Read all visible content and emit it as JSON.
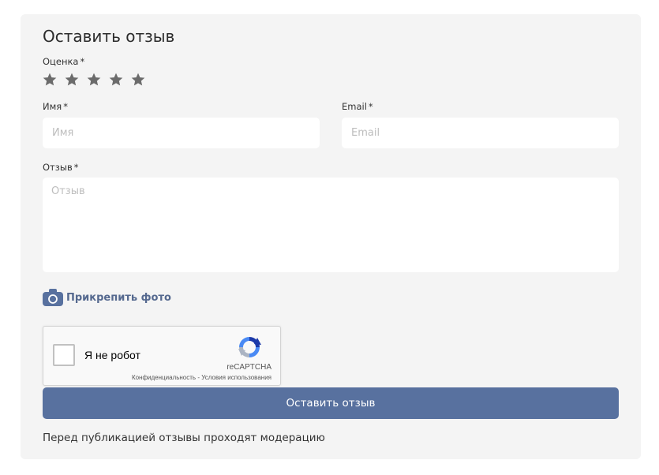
{
  "form": {
    "title": "Оставить отзыв",
    "rating_label": "Оценка",
    "required_mark": "*",
    "stars": 5,
    "name_label": "Имя",
    "name_placeholder": "Имя",
    "email_label": "Email",
    "email_placeholder": "Email",
    "review_label": "Отзыв",
    "review_placeholder": "Отзыв",
    "attach_photo": "Прикрепить фото",
    "submit_label": "Оставить отзыв",
    "moderation_note": "Перед публикацией отзывы проходят модерацию"
  },
  "recaptcha": {
    "label": "Я не робот",
    "brand": "reCAPTCHA",
    "privacy": "Конфиденциальность",
    "separator": " - ",
    "terms": "Условия использования"
  },
  "colors": {
    "accent": "#58719f",
    "card_bg": "#f4f4f4",
    "star": "#6b6b6b"
  },
  "icons": [
    "star-icon",
    "camera-icon",
    "recaptcha-logo-icon"
  ]
}
